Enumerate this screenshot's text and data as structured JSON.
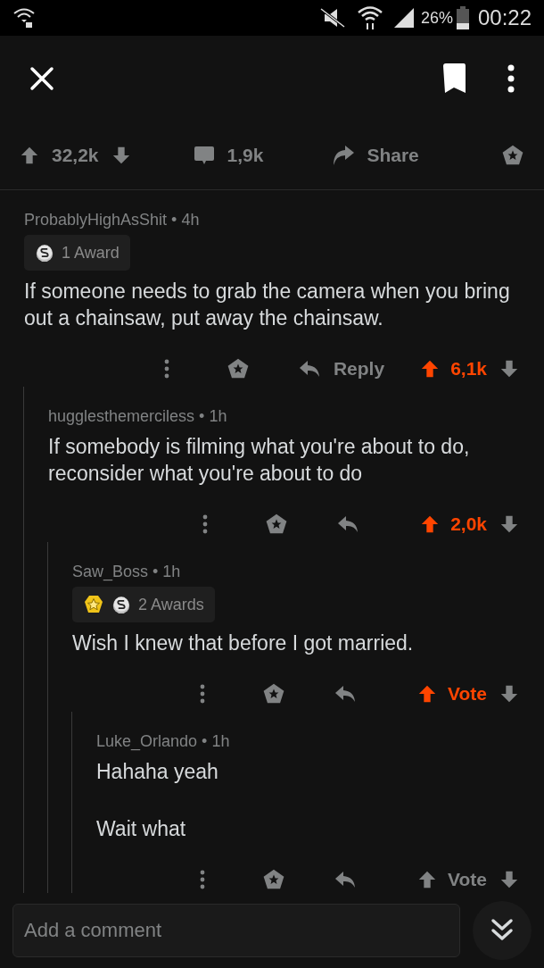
{
  "status_bar": {
    "battery": "26%",
    "time": "00:22"
  },
  "post_actions": {
    "score": "32,2k",
    "comments": "1,9k",
    "share": "Share"
  },
  "comments": [
    {
      "meta": "ProbablyHighAsShit • 4h",
      "awards": {
        "label": "1 Award",
        "icons": [
          {
            "kind": "silver"
          }
        ]
      },
      "body": [
        "If someone needs to grab the camera when you bring out a chainsaw, put away the chainsaw."
      ],
      "reply_label": "Reply",
      "vote": "6,1k",
      "upvoted": true,
      "children": [
        {
          "meta": "hugglesthemerciless • 1h",
          "body": [
            "If somebody is filming what you're about to do, reconsider what you're about to do"
          ],
          "vote": "2,0k",
          "upvoted": true,
          "children": [
            {
              "meta": "Saw_Boss • 1h",
              "awards": {
                "label": "2 Awards",
                "icons": [
                  {
                    "kind": "gold"
                  },
                  {
                    "kind": "silver"
                  }
                ]
              },
              "body": [
                "Wish I knew that before I got married."
              ],
              "vote": "Vote",
              "upvoted": true,
              "children": [
                {
                  "meta": "Luke_Orlando • 1h",
                  "body": [
                    "Hahaha yeah",
                    "Wait what"
                  ],
                  "vote": "Vote",
                  "upvoted": false
                }
              ]
            }
          ]
        }
      ]
    }
  ],
  "composer": {
    "placeholder": "Add a comment"
  }
}
